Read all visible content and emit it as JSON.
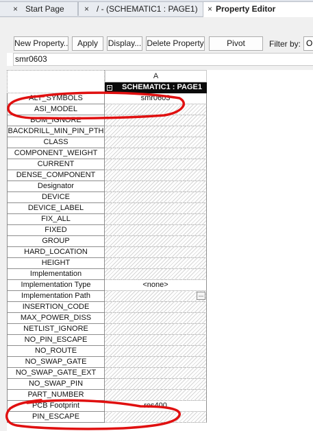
{
  "tabs": [
    {
      "label": "Start Page",
      "close": "×",
      "active": false
    },
    {
      "label": "/ - (SCHEMATIC1 : PAGE1)",
      "close": "×",
      "active": false
    },
    {
      "label": "Property Editor",
      "close": "×",
      "active": true
    }
  ],
  "toolbar": {
    "new_property": "New Property...",
    "apply": "Apply",
    "display": "Display...",
    "delete_property": "Delete Property",
    "pivot": "Pivot",
    "filter_label": "Filter by:",
    "filter_value": "Or"
  },
  "edit_value": "smr0603",
  "grid": {
    "column_letter": "A",
    "column_header": "SCHEMATIC1 : PAGE1",
    "expand_glyph": "+",
    "rows": [
      {
        "name": "ALT_SYMBOLS",
        "value": "smr0603"
      },
      {
        "name": "ASI_MODEL",
        "value": ""
      },
      {
        "name": "BOM_IGNORE",
        "value": ""
      },
      {
        "name": "BACKDRILL_MIN_PIN_PTH",
        "value": ""
      },
      {
        "name": "CLASS",
        "value": ""
      },
      {
        "name": "COMPONENT_WEIGHT",
        "value": ""
      },
      {
        "name": "CURRENT",
        "value": ""
      },
      {
        "name": "DENSE_COMPONENT",
        "value": ""
      },
      {
        "name": "Designator",
        "value": ""
      },
      {
        "name": "DEVICE",
        "value": ""
      },
      {
        "name": "DEVICE_LABEL",
        "value": ""
      },
      {
        "name": "FIX_ALL",
        "value": ""
      },
      {
        "name": "FIXED",
        "value": ""
      },
      {
        "name": "GROUP",
        "value": ""
      },
      {
        "name": "HARD_LOCATION",
        "value": ""
      },
      {
        "name": "HEIGHT",
        "value": ""
      },
      {
        "name": "Implementation",
        "value": ""
      },
      {
        "name": "Implementation Type",
        "value": "<none>"
      },
      {
        "name": "Implementation Path",
        "value": "",
        "ellipsis": "..."
      },
      {
        "name": "INSERTION_CODE",
        "value": ""
      },
      {
        "name": "MAX_POWER_DISS",
        "value": ""
      },
      {
        "name": "NETLIST_IGNORE",
        "value": ""
      },
      {
        "name": "NO_PIN_ESCAPE",
        "value": ""
      },
      {
        "name": "NO_ROUTE",
        "value": ""
      },
      {
        "name": "NO_SWAP_GATE",
        "value": ""
      },
      {
        "name": "NO_SWAP_GATE_EXT",
        "value": ""
      },
      {
        "name": "NO_SWAP_PIN",
        "value": ""
      },
      {
        "name": "PART_NUMBER",
        "value": ""
      },
      {
        "name": "PCB Footprint",
        "value": "res400"
      },
      {
        "name": "PIN_ESCAPE",
        "value": ""
      }
    ]
  },
  "colors": {
    "annotation": "#e01010",
    "header_bg": "#0a0a0a"
  }
}
